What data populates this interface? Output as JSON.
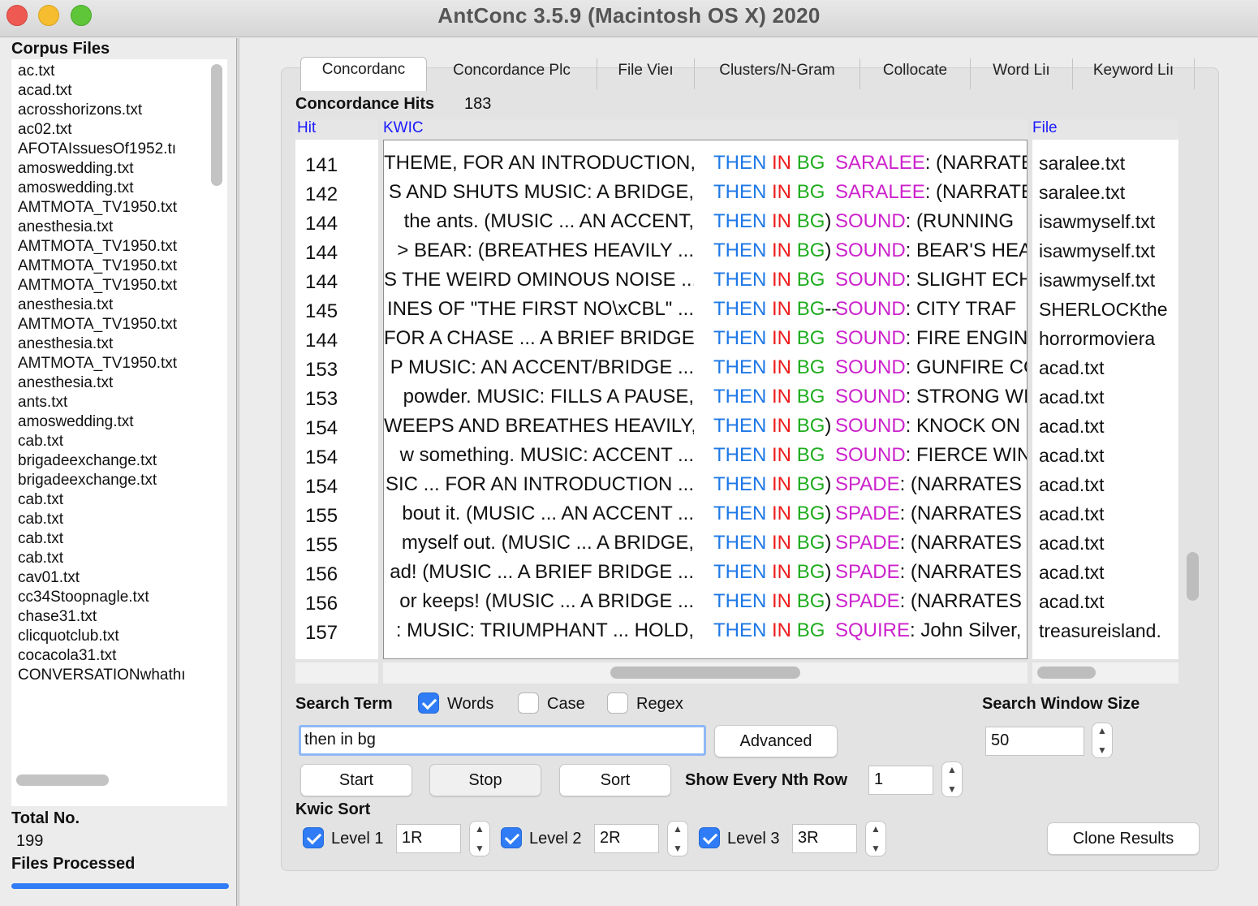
{
  "window": {
    "title": "AntConc 3.5.9 (Macintosh OS X) 2020"
  },
  "left": {
    "corpus_heading": "Corpus Files",
    "files": [
      "ac.txt",
      "acad.txt",
      "acrosshorizons.txt",
      "ac02.txt",
      "AFOTAIssuesOf1952.tı",
      "amoswedding.txt",
      "amoswedding.txt",
      "AMTMOTA_TV1950.txt",
      "anesthesia.txt",
      "AMTMOTA_TV1950.txt",
      "AMTMOTA_TV1950.txt",
      "AMTMOTA_TV1950.txt",
      "anesthesia.txt",
      "AMTMOTA_TV1950.txt",
      "anesthesia.txt",
      "AMTMOTA_TV1950.txt",
      "anesthesia.txt",
      "ants.txt",
      "amoswedding.txt",
      "cab.txt",
      "brigadeexchange.txt",
      "brigadeexchange.txt",
      "cab.txt",
      "cab.txt",
      "cab.txt",
      "cab.txt",
      "cav01.txt",
      "cc34Stoopnagle.txt",
      "chase31.txt",
      "clicquotclub.txt",
      "cocacola31.txt",
      "CONVERSATIONwhathı"
    ],
    "total_label": "Total No.",
    "total_value": "199",
    "files_processed_label": "Files Processed"
  },
  "tabs": [
    "Concordanc",
    "Concordance Plc",
    "File Vieı",
    "Clusters/N-Gram",
    "Collocate",
    "Word Liı",
    "Keyword Liı"
  ],
  "hits": {
    "label": "Concordance Hits",
    "value": "183"
  },
  "columns": {
    "hit": "Hit",
    "kwic": "KWIC",
    "file": "File"
  },
  "rows": [
    {
      "hit": "141",
      "left": "THEME, FOR AN INTRODUCTION,",
      "t": "THEN",
      "i": "IN",
      "b": "BG",
      "sep": "",
      "m": "SARALEE",
      "rest": ": (NARRATES",
      "file": "saralee.txt"
    },
    {
      "hit": "142",
      "left": "S AND SHUTS  MUSIC: A BRIDGE,",
      "t": "THEN",
      "i": "IN",
      "b": "BG",
      "sep": "",
      "m": "SARALEE",
      "rest": ": (NARRATES",
      "file": "saralee.txt"
    },
    {
      "hit": "144",
      "left": "the  ants.  (MUSIC ... AN ACCENT,",
      "t": "THEN",
      "i": "IN",
      "b": "BG",
      "sep": ")",
      "m": "SOUND",
      "rest": ": (RUNNING",
      "file": "isawmyself.txt"
    },
    {
      "hit": "144",
      "left": ">   BEAR: (BREATHES HEAVILY ...",
      "t": "THEN",
      "i": "IN",
      "b": "BG",
      "sep": ")",
      "m": "SOUND",
      "rest": ": BEAR'S HEA",
      "file": "isawmyself.txt"
    },
    {
      "hit": "144",
      "left": "S THE WEIRD OMINOUS NOISE ...",
      "t": "THEN",
      "i": "IN",
      "b": "BG",
      "sep": "",
      "m": "SOUND",
      "rest": ": SLIGHT ECHO",
      "file": "isawmyself.txt"
    },
    {
      "hit": "145",
      "left": "INES OF \"THE FIRST NO\\xCBL\" ...",
      "t": "THEN",
      "i": "IN",
      "b": "BG",
      "sep": "--",
      "m": "SOUND",
      "rest": ": CITY TRAF",
      "file": "SHERLOCKthe"
    },
    {
      "hit": "144",
      "left": "FOR A CHASE ... A BRIEF BRIDGE,",
      "t": "THEN",
      "i": "IN",
      "b": "BG",
      "sep": "",
      "m": "SOUND",
      "rest": ": FIRE ENGINE",
      "file": "horrormoviera"
    },
    {
      "hit": "153",
      "left": "P  MUSIC: AN ACCENT/BRIDGE ...",
      "t": "THEN",
      "i": "IN",
      "b": "BG",
      "sep": "",
      "m": "SOUND",
      "rest": ": GUNFIRE CO",
      "file": "acad.txt"
    },
    {
      "hit": "153",
      "left": "powder.   MUSIC: FILLS A PAUSE,",
      "t": "THEN",
      "i": "IN",
      "b": "BG",
      "sep": "",
      "m": "SOUND",
      "rest": ": STRONG WI",
      "file": "acad.txt"
    },
    {
      "hit": "154",
      "left": "WEEPS AND BREATHES HEAVILY,",
      "t": "THEN",
      "i": "IN",
      "b": "BG",
      "sep": ")",
      "m": "SOUND",
      "rest": ": KNOCK ON",
      "file": "acad.txt"
    },
    {
      "hit": "154",
      "left": "w something.  MUSIC: ACCENT ...",
      "t": "THEN",
      "i": "IN",
      "b": "BG",
      "sep": "",
      "m": "SOUND",
      "rest": ": FIERCE WIN",
      "file": "acad.txt"
    },
    {
      "hit": "154",
      "left": "SIC ... FOR AN INTRODUCTION ...",
      "t": "THEN",
      "i": "IN",
      "b": "BG",
      "sep": ")",
      "m": "SPADE",
      "rest": ": (NARRATES",
      "file": "acad.txt"
    },
    {
      "hit": "155",
      "left": "bout it.  (MUSIC ... AN ACCENT ...",
      "t": "THEN",
      "i": "IN",
      "b": "BG",
      "sep": ")",
      "m": "SPADE",
      "rest": ": (NARRATES",
      "file": "acad.txt"
    },
    {
      "hit": "155",
      "left": "myself out.  (MUSIC ... A BRIDGE,",
      "t": "THEN",
      "i": "IN",
      "b": "BG",
      "sep": ")",
      "m": "SPADE",
      "rest": ": (NARRATES",
      "file": "acad.txt"
    },
    {
      "hit": "156",
      "left": "ad!  (MUSIC ... A BRIEF BRIDGE ...",
      "t": "THEN",
      "i": "IN",
      "b": "BG",
      "sep": ")",
      "m": "SPADE",
      "rest": ": (NARRATES",
      "file": "acad.txt"
    },
    {
      "hit": "156",
      "left": "or keeps!  (MUSIC ... A BRIDGE ...",
      "t": "THEN",
      "i": "IN",
      "b": "BG",
      "sep": ")",
      "m": "SPADE",
      "rest": ": (NARRATES",
      "file": "acad.txt"
    },
    {
      "hit": "157",
      "left": ":  MUSIC: TRIUMPHANT ... HOLD,",
      "t": "THEN",
      "i": "IN",
      "b": "BG",
      "sep": "",
      "m": "SQUIRE",
      "rest": ": John Silver,",
      "file": "treasureisland."
    }
  ],
  "extra_hit_numbers": [
    "157"
  ],
  "search": {
    "term_label": "Search Term",
    "words_label": "Words",
    "words_checked": true,
    "case_label": "Case",
    "case_checked": false,
    "regex_label": "Regex",
    "regex_checked": false,
    "query": "then in bg",
    "advanced_label": "Advanced",
    "window_size_label": "Search Window Size",
    "window_size": "50",
    "start_label": "Start",
    "stop_label": "Stop",
    "sort_label": "Sort",
    "nth_row_label": "Show Every Nth Row",
    "nth_row": "1"
  },
  "kwic_sort": {
    "label": "Kwic Sort",
    "levels": [
      {
        "label": "Level 1",
        "value": "1R",
        "checked": true
      },
      {
        "label": "Level 2",
        "value": "2R",
        "checked": true
      },
      {
        "label": "Level 3",
        "value": "3R",
        "checked": true
      }
    ],
    "clone_label": "Clone Results"
  },
  "colors": {
    "then": "#1e78e6",
    "in": "#ee1c1c",
    "bg": "#1fad1f",
    "match": "#cc22cc",
    "header_link": "#1a1aff",
    "accent": "#2f7cf6"
  }
}
